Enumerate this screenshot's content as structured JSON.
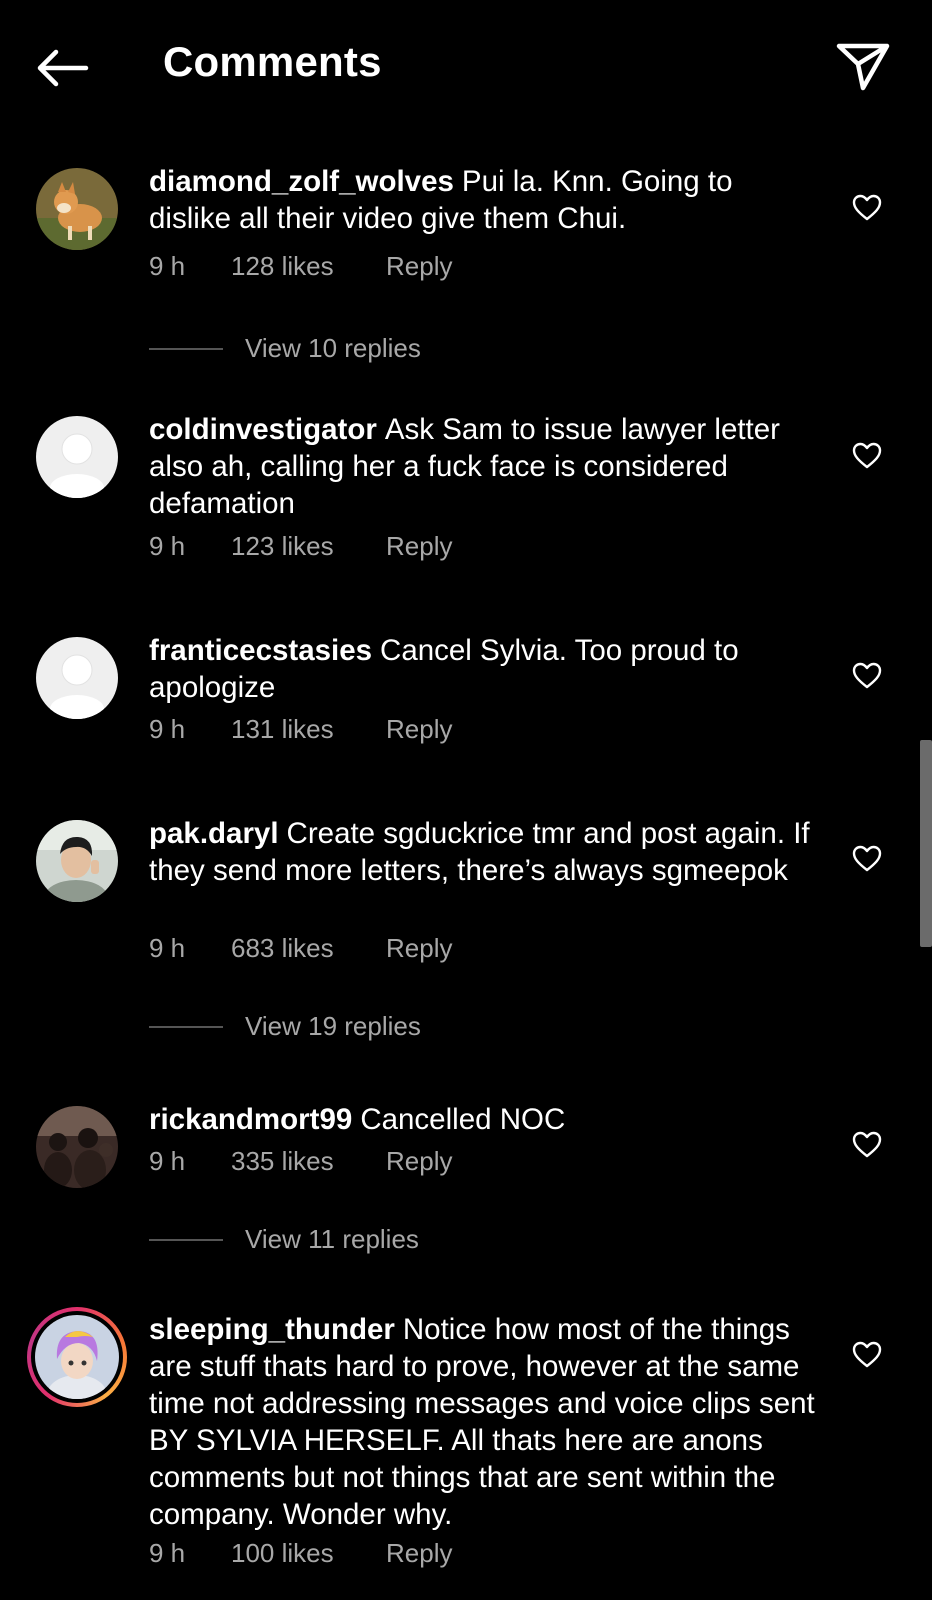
{
  "header": {
    "back_icon": "arrow-left-icon",
    "title": "Comments",
    "send_icon": "paper-plane-icon"
  },
  "comments": [
    {
      "username": "diamond_zolf_wolves",
      "text": "Pui la. Knn. Going to dislike all their video give them Chui.",
      "time": "9 h",
      "likes": "128 likes",
      "reply": "Reply",
      "view_replies": "View 10 replies",
      "avatar": "shiba-dog-avatar"
    },
    {
      "username": "coldinvestigator",
      "text": "Ask Sam to issue lawyer letter also ah, calling her a fuck face is considered defamation",
      "time": "9 h",
      "likes": "123 likes",
      "reply": "Reply",
      "avatar": "default-avatar"
    },
    {
      "username": "franticecstasies",
      "text": "Cancel Sylvia. Too proud to apologize",
      "time": "9 h",
      "likes": "131 likes",
      "reply": "Reply",
      "avatar": "default-avatar"
    },
    {
      "username": "pak.daryl",
      "text": "Create sgduckrice tmr and post again. If they send more letters, there’s always sgmeepok",
      "time": "9 h",
      "likes": "683 likes",
      "reply": "Reply",
      "view_replies": "View 19 replies",
      "avatar": "person-photo-avatar"
    },
    {
      "username": "rickandmort99",
      "text": "Cancelled NOC",
      "time": "9 h",
      "likes": "335 likes",
      "reply": "Reply",
      "view_replies": "View 11 replies",
      "avatar": "group-photo-avatar"
    },
    {
      "username": "sleeping_thunder",
      "text": "Notice how most of the things are stuff thats hard to prove, however at the same time not addressing messages and voice clips sent BY SYLVIA HERSELF. All thats here are anons comments but not things that are sent within the company. Wonder why.",
      "time": "9 h",
      "likes": "100 likes",
      "reply": "Reply",
      "avatar": "anime-character-avatar"
    }
  ],
  "colors": {
    "background": "#000000",
    "text": "#ffffff",
    "secondary_text": "#a8a8a8",
    "story_ring": "#e1306c"
  }
}
